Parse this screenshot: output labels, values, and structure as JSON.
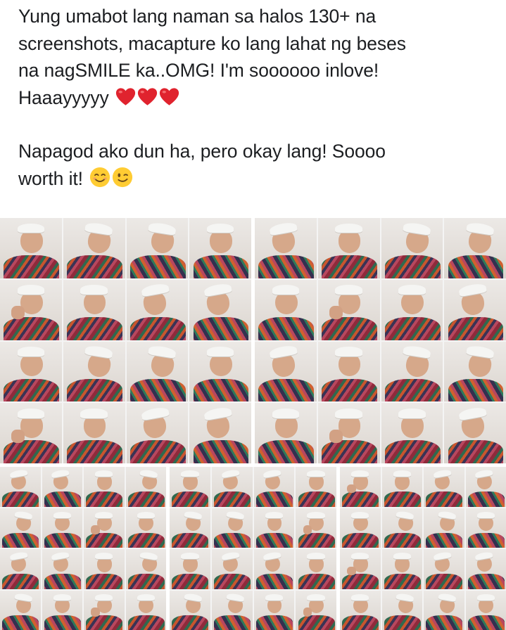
{
  "post": {
    "line1": "Yung umabot lang naman sa halos 130+ na",
    "line2": "screenshots, macapture ko lang lahat ng beses",
    "line3": "na nagSMILE ka..OMG! I'm soooooo inlove!",
    "line4": "Haaayyyyy",
    "line5": "Napagod ako dun ha, pero okay lang! Soooo",
    "line6": "worth it!",
    "emojis_line4": [
      "red-heart-icon",
      "red-heart-icon",
      "red-heart-icon"
    ],
    "emojis_line6": [
      "smiling-face-icon",
      "winking-face-icon"
    ]
  },
  "colors": {
    "text": "#1c1e21",
    "heart": "#e0232e",
    "emoji_face": "#ffcc33",
    "shirt_palette": [
      "#8f2a3b",
      "#2f6a4f",
      "#c9552e",
      "#3a3355",
      "#b8475e"
    ]
  },
  "photos": {
    "collages": [
      {
        "name": "collage-top-left",
        "rows": 4,
        "cols": 4
      },
      {
        "name": "collage-top-right",
        "rows": 4,
        "cols": 4
      },
      {
        "name": "collage-bottom-left",
        "rows": 4,
        "cols": 4
      },
      {
        "name": "collage-bottom-middle",
        "rows": 4,
        "cols": 4
      },
      {
        "name": "collage-bottom-right",
        "rows": 4,
        "cols": 4
      }
    ]
  }
}
